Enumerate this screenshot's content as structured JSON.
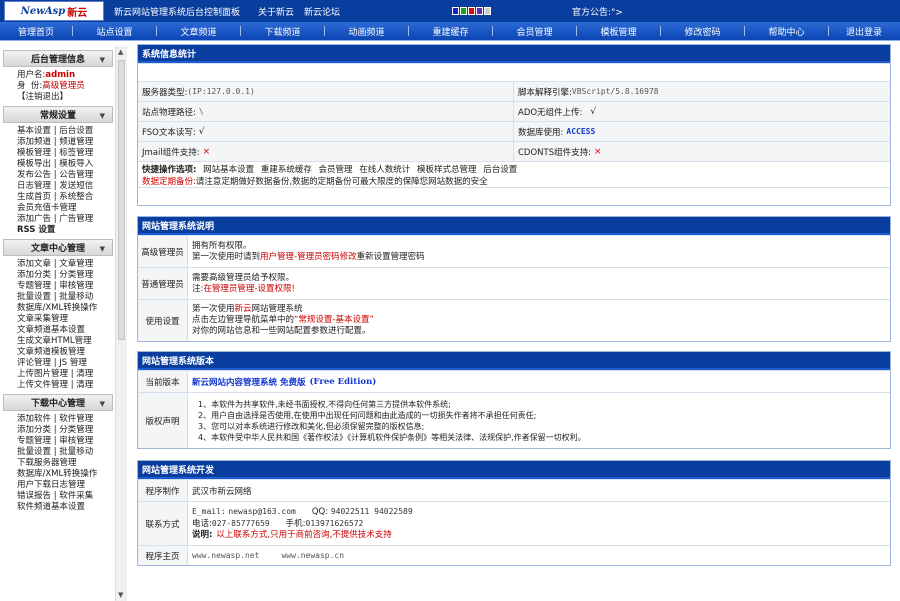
{
  "top": {
    "logo_en": "NewAsp",
    "logo_cn": "新云",
    "title": "新云网站管理系统后台控制面板",
    "links": [
      "关于新云",
      "新云论坛"
    ],
    "notice": "官方公告:\">",
    "swatch_colors": [
      "#1a22c8",
      "#20a020",
      "#d01010",
      "#6a2ab0",
      "#cccccc"
    ]
  },
  "nav": [
    "管理首页",
    "站点设置",
    "文章频道",
    "下载频道",
    "动画频道",
    "重建缓存",
    "会员管理",
    "模板管理",
    "修改密码",
    "帮助中心",
    "退出登录"
  ],
  "sidebar": {
    "info": {
      "title": "后台管理信息",
      "user_label": "用户名:",
      "user": "admin",
      "role_label": "身  份:",
      "role": "高级管理员",
      "logout": "【注销退出】"
    },
    "sections": [
      {
        "title": "常规设置",
        "items": [
          "基本设置 | 后台设置",
          "添加频道 | 频道管理",
          "模板管理 | 标签管理",
          "模板导出 | 模板导入",
          "发布公告 | 公告管理",
          "日志管理 | 发送短信",
          "生成首页 | 系统整合",
          "会员充值卡管理",
          "添加广告 | 广告管理",
          "RSS 设置"
        ]
      },
      {
        "title": "文章中心管理",
        "items": [
          "添加文章 | 文章管理",
          "添加分类 | 分类管理",
          "专题管理 | 审核管理",
          "批量设置 | 批量移动",
          "数据库/XML转换操作",
          "文章采集管理",
          "文章频道基本设置",
          "生成文章HTML管理",
          "文章频道模板管理",
          "评论管理 | JS 管理",
          "上传图片管理 | 清理",
          "上传文件管理 | 清理"
        ]
      },
      {
        "title": "下载中心管理",
        "items": [
          "添加软件 | 软件管理",
          "添加分类 | 分类管理",
          "专题管理 | 审核管理",
          "批量设置 | 批量移动",
          "下载服务器管理",
          "数据库/XML转换操作",
          "用户下载日志管理",
          "错误报告 | 软件采集",
          "软件频道基本设置"
        ]
      }
    ]
  },
  "sysinfo": {
    "title": "系统信息统计",
    "server_type_label": "服务器类型:",
    "server_type": "(IP:127.0.0.1)",
    "script_label": "脚本解释引擎:",
    "script": "VBScript/5.8.16978",
    "path_label": "站点物理路径:",
    "path": "\\",
    "adodb_label": "ADO无组件上传:",
    "adodb": "√",
    "fso_label": "FSO文本读写:",
    "fso": "√",
    "db_label": "数据库使用:",
    "db": "ACCESS",
    "jmail_label": "Jmail组件支持:",
    "jmail": "×",
    "cdonts_label": "CDONTS组件支持:",
    "cdonts": "×",
    "quick_label": "快捷操作选项:",
    "quick_links": [
      "网站基本设置",
      "重建系统缓存",
      "会员管理",
      "在线人数统计",
      "模板样式总管理",
      "后台设置"
    ],
    "backup_label": "数据定期备份:",
    "backup_text": "请注意定期做好数据备份,数据的定期备份可最大限度的保障您网站数据的安全"
  },
  "mgmt": {
    "title": "网站管理系统说明",
    "rows": [
      {
        "label": "高级管理员",
        "line1": "拥有所有权限。",
        "line2_a": "第一次使用时请到",
        "line2_red": "用户管理-管理员密码修改",
        "line2_b": "重新设置管理密码"
      },
      {
        "label": "普通管理员",
        "line1": "需要高级管理员给予权限。",
        "line2_a": "注:",
        "line2_red": "在管理员管理-设置权限!",
        "line2_b": ""
      },
      {
        "label": "使用设置",
        "line1_a": "第一次使用",
        "line1_red": "新云",
        "line1_b": "网站管理系统",
        "line2_a": "点击左边管理导航菜单中的",
        "line2_red": "“常规设置-基本设置”",
        "line2_b": "",
        "line3": "对你的网站信息和一些网站配置参数进行配置。"
      }
    ]
  },
  "version": {
    "title": "网站管理系统版本",
    "ver_label": "当前版本",
    "ver_text": "新云网站内容管理系统 免费版",
    "ver_edition": "(Free Edition)",
    "copy_label": "版权声明",
    "copy_lines": [
      "1、本软件为共享软件,未经书面授权,不得向任何第三方提供本软件系统;",
      "2、用户自由选择是否使用,在使用中出现任何问题和由此造成的一切损失作者将不承担任何责任;",
      "3、您可以对本系统进行修改和美化,但必须保留完整的版权信息;",
      "4、本软件受中华人民共和国《著作权法》《计算机软件保护条例》等相关法律、法规保护,作者保留一切权利。"
    ]
  },
  "dev": {
    "title": "网站管理系统开发",
    "maker_label": "程序制作",
    "maker": "武汉市新云网络",
    "contact_label": "联系方式",
    "email_label": "E_mail:",
    "email": "newasp@163.com",
    "qq_label": "QQ:",
    "qq": "94022511  94022589",
    "phone_label": "电话:",
    "phone": "027-85777659",
    "mobile_label": "手机:",
    "mobile": "013971626572",
    "note_label": "说明:",
    "note": "以上联系方式,只用于商前咨询,不提供技术支持",
    "home_label": "程序主页",
    "home1": "www.newasp.net",
    "home2": "www.newasp.cn"
  }
}
